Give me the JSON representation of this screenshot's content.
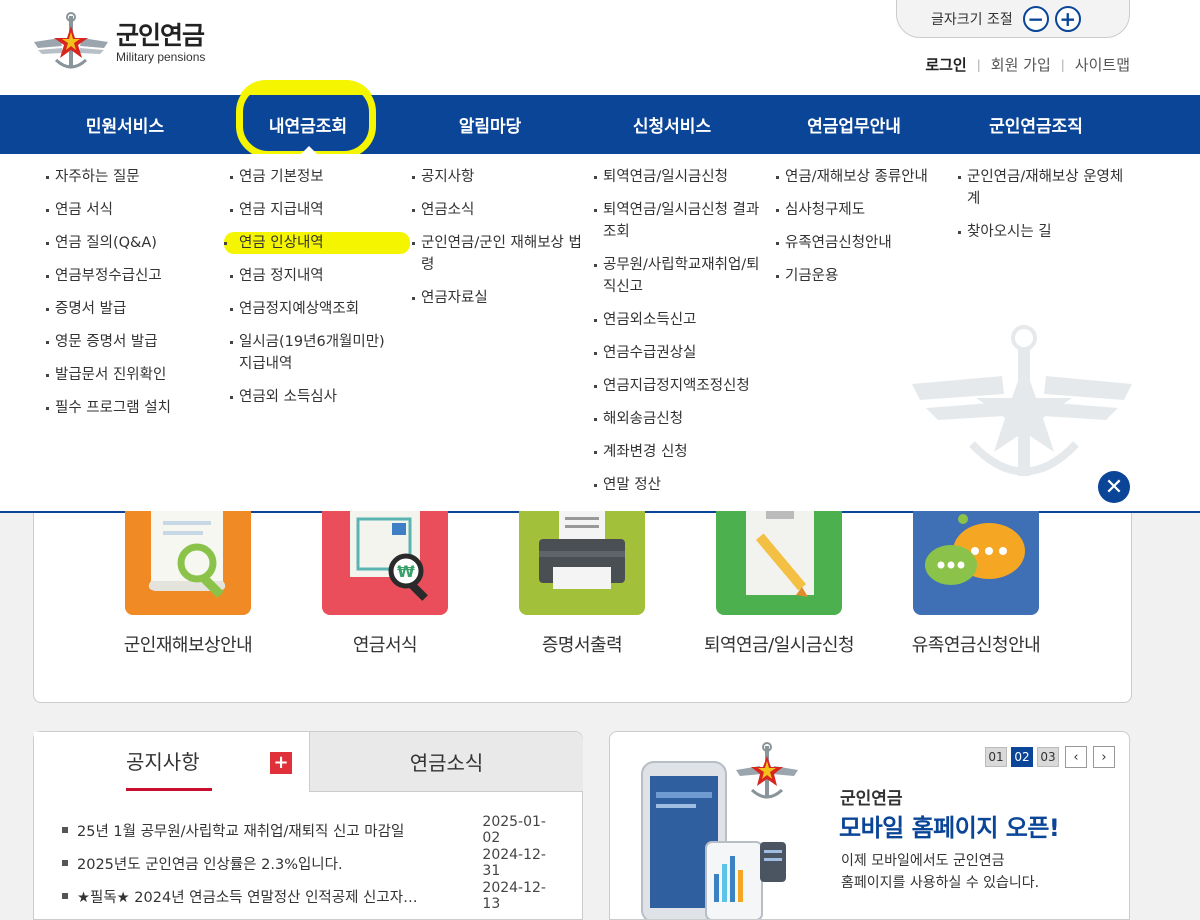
{
  "header": {
    "logo_title": "군인연금",
    "logo_subtitle": "Military pensions",
    "fontsize_label": "글자크기 조절",
    "fontsize_minus": "−",
    "fontsize_plus": "+",
    "links": {
      "login": "로그인",
      "signup": "회원 가입",
      "sitemap": "사이트맵"
    }
  },
  "nav": {
    "items": [
      "민원서비스",
      "내연금조회",
      "알림마당",
      "신청서비스",
      "연금업무안내",
      "군인연금조직"
    ]
  },
  "mega": {
    "col1": [
      "자주하는 질문",
      "연금 서식",
      "연금 질의(Q&A)",
      "연금부정수급신고",
      "증명서 발급",
      "영문 증명서 발급",
      "발급문서 진위확인",
      "필수 프로그램 설치"
    ],
    "col2": [
      "연금 기본정보",
      "연금 지급내역",
      "연금 인상내역",
      "연금 정지내역",
      "연금정지예상액조회",
      "일시금(19년6개월미만) 지급내역",
      "연금외 소득심사"
    ],
    "col3": [
      "공지사항",
      "연금소식",
      "군인연금/군인 재해보상 법령",
      "연금자료실"
    ],
    "col4": [
      "퇴역연금/일시금신청",
      "퇴역연금/일시금신청 결과조회",
      "공무원/사립학교재취업/퇴직신고",
      "연금외소득신고",
      "연금수급권상실",
      "연금지급정지액조정신청",
      "해외송금신청",
      "계좌변경 신청",
      "연말 정산"
    ],
    "col5": [
      "연금/재해보상 종류안내",
      "심사청구제도",
      "유족연금신청안내",
      "기금운용"
    ],
    "col6": [
      "군인연금/재해보상 운영체계",
      "찾아오시는 길"
    ],
    "close_symbol": "✕"
  },
  "quick": {
    "items": [
      "군인재해보상안내",
      "연금서식",
      "증명서출력",
      "퇴역연금/일시금신청",
      "유족연금신청안내"
    ],
    "colors": [
      "#f08a24",
      "#e94e5a",
      "#a3c03a",
      "#4cb04e",
      "#3f6fb5"
    ]
  },
  "notice": {
    "tab_active": "공지사항",
    "tab_inactive": "연금소식",
    "plus": "+",
    "rows": [
      {
        "title": "25년 1월 공무원/사립학교 재취업/재퇴직 신고 마감일",
        "date": "2025-01-02"
      },
      {
        "title": "2025년도 군인연금 인상률은 2.3%입니다.",
        "date": "2024-12-31"
      },
      {
        "title": "★필독★ 2024년 연금소득 연말정산 인적공제 신고자…",
        "date": "2024-12-13"
      }
    ]
  },
  "banner": {
    "pages": [
      "01",
      "02",
      "03"
    ],
    "active_page": "02",
    "prev": "‹",
    "next": "›",
    "small_title": "군인연금",
    "big_title": "모바일 홈페이지 오픈!",
    "desc_line1": "이제 모바일에서도 군인연금",
    "desc_line2": "홈페이지를 사용하실 수 있습니다."
  },
  "colors": {
    "primary": "#0a4597",
    "accent_red": "#c8102e",
    "highlight": "#f5f500"
  }
}
